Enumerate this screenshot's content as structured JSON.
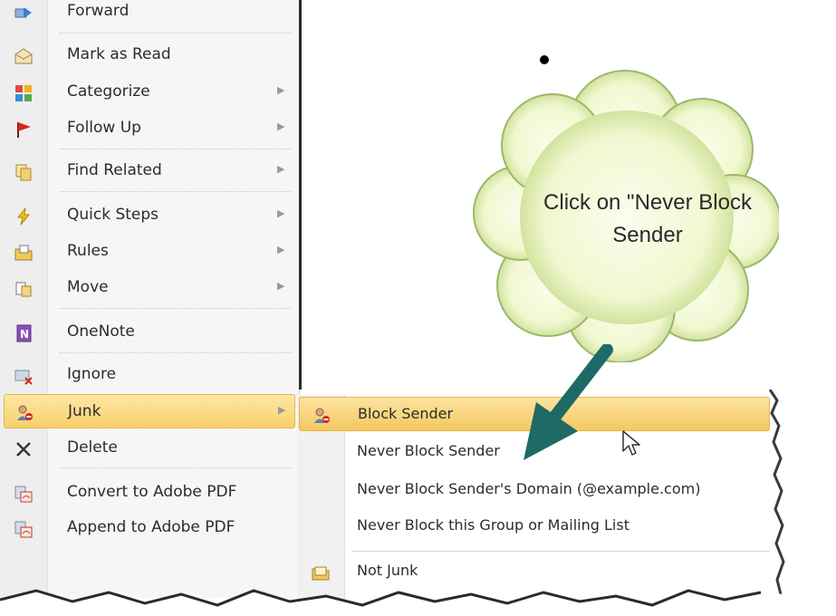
{
  "context_menu": {
    "items": [
      {
        "label": "Forward",
        "icon": "forward-icon",
        "submenu": false
      },
      {
        "label": "Mark as Read",
        "icon": "envelope-open-icon",
        "submenu": false
      },
      {
        "label": "Categorize",
        "icon": "categorize-icon",
        "submenu": true
      },
      {
        "label": "Follow Up",
        "icon": "flag-icon",
        "submenu": true
      },
      {
        "label": "Find Related",
        "icon": "find-related-icon",
        "submenu": true
      },
      {
        "label": "Quick Steps",
        "icon": "lightning-icon",
        "submenu": true
      },
      {
        "label": "Rules",
        "icon": "rules-icon",
        "submenu": true
      },
      {
        "label": "Move",
        "icon": "move-icon",
        "submenu": true
      },
      {
        "label": "OneNote",
        "icon": "onenote-icon",
        "submenu": false
      },
      {
        "label": "Ignore",
        "icon": "ignore-icon",
        "submenu": false
      },
      {
        "label": "Junk",
        "icon": "junk-icon",
        "submenu": true,
        "selected": true
      },
      {
        "label": "Delete",
        "icon": "delete-icon",
        "submenu": false
      },
      {
        "label": "Convert to Adobe PDF",
        "icon": "pdf-convert-icon",
        "submenu": false
      },
      {
        "label": "Append to Adobe PDF",
        "icon": "pdf-append-icon",
        "submenu": false
      }
    ]
  },
  "junk_submenu": {
    "items": [
      {
        "label": "Block Sender",
        "icon": "block-sender-icon",
        "selected": true
      },
      {
        "label": "Never Block Sender",
        "icon": ""
      },
      {
        "label": "Never Block Sender's Domain (@example.com)",
        "icon": ""
      },
      {
        "label": "Never Block this Group or Mailing List",
        "icon": ""
      },
      {
        "label": "Not Junk",
        "icon": "not-junk-icon"
      }
    ]
  },
  "callout": {
    "text": "Click on \"Never Block Sender"
  },
  "colors": {
    "highlight": "#f8cf6a",
    "cloud_fill": "#f2f8d2",
    "cloud_glow": "#c9dd8e",
    "arrow": "#1e6a66"
  }
}
